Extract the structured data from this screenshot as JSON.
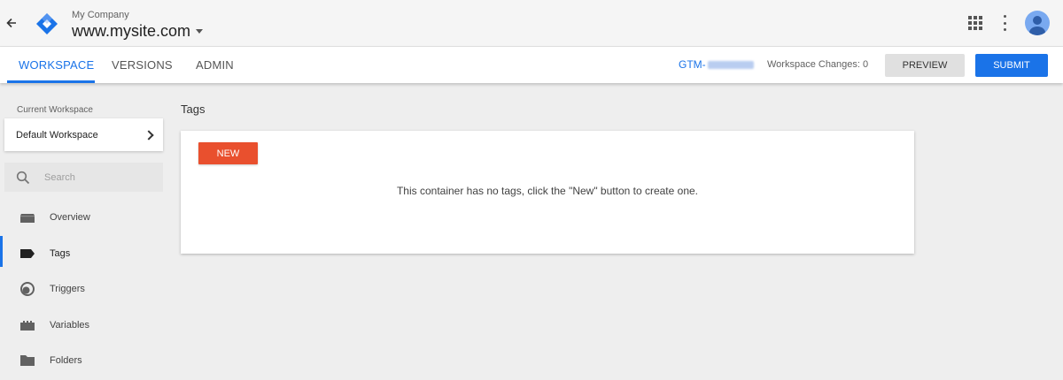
{
  "header": {
    "account_name": "My Company",
    "container_name": "www.mysite.com"
  },
  "tabs": [
    {
      "label": "WORKSPACE",
      "active": true
    },
    {
      "label": "VERSIONS",
      "active": false
    },
    {
      "label": "ADMIN",
      "active": false
    }
  ],
  "toolbar": {
    "container_id_prefix": "GTM-",
    "workspace_changes": "Workspace Changes: 0",
    "preview_label": "PREVIEW",
    "submit_label": "SUBMIT"
  },
  "sidebar": {
    "current_workspace_label": "Current Workspace",
    "workspace_name": "Default Workspace",
    "search": {
      "placeholder": "Search",
      "value": ""
    },
    "items": [
      {
        "label": "Overview",
        "icon": "overview-icon",
        "active": false
      },
      {
        "label": "Tags",
        "icon": "tag-icon",
        "active": true
      },
      {
        "label": "Triggers",
        "icon": "trigger-icon",
        "active": false
      },
      {
        "label": "Variables",
        "icon": "variables-icon",
        "active": false
      },
      {
        "label": "Folders",
        "icon": "folder-icon",
        "active": false
      }
    ]
  },
  "main": {
    "title": "Tags",
    "new_label": "NEW",
    "empty_message": "This container has no tags, click the \"New\" button to create one."
  },
  "colors": {
    "accent": "#1a73e8",
    "new_button": "#e9502e",
    "background": "#eeeeee"
  }
}
